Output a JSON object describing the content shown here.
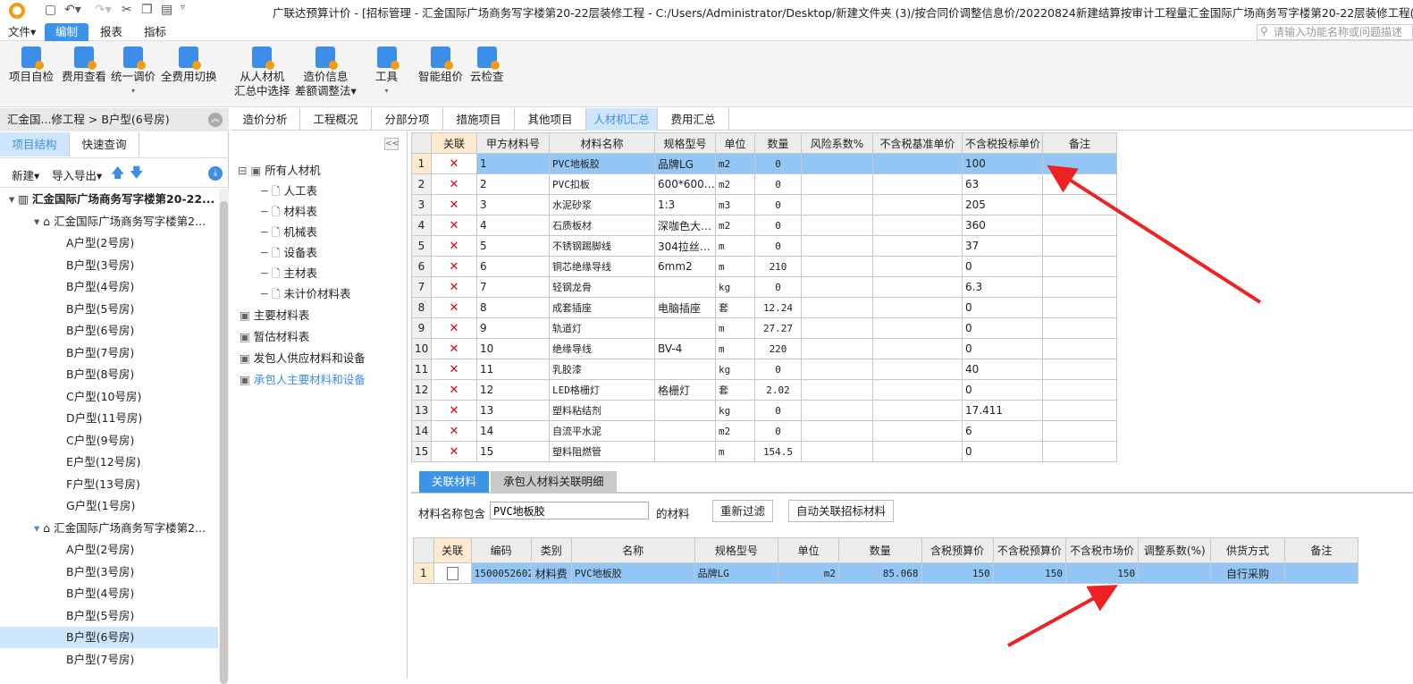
{
  "window": {
    "title": "广联达预算计价 - [招标管理 - 汇金国际广场商务写字楼第20-22层装修工程 - C:/Users/Administrator/Desktop/新建文件夹 (3)/按合同价调整信息价/20220824新建结算按审计工程量汇金国际广场商务写字楼第20-22层装修工程(合同内).G"
  },
  "menu": [
    "文件▾",
    "编制",
    "报表",
    "指标"
  ],
  "search_placeholder": "请输入功能名称或问题描述",
  "ribbon": [
    {
      "l1": "项目自检",
      "l2": ""
    },
    {
      "l1": "费用查看",
      "l2": ""
    },
    {
      "l1": "统一调价",
      "l2": "▾"
    },
    {
      "l1": "全费用切换",
      "l2": ""
    },
    {
      "l1": "从人材机",
      "l2": "汇总中选择"
    },
    {
      "l1": "造价信息",
      "l2": "差额调整法▾"
    },
    {
      "l1": "工具",
      "l2": "▾"
    },
    {
      "l1": "智能组价",
      "l2": ""
    },
    {
      "l1": "云检查",
      "l2": ""
    }
  ],
  "left": {
    "breadcrumb": "汇金国...修工程 > B户型(6号房)",
    "tabs": [
      "项目结构",
      "快速查询"
    ],
    "tools": {
      "new": "新建▾",
      "import": "导入导出▾"
    },
    "tree": [
      "汇金国际广场商务写字楼第20-22...",
      "汇金国际广场商务写字楼第2...",
      "A户型(2号房)",
      "B户型(3号房)",
      "B户型(4号房)",
      "B户型(5号房)",
      "B户型(6号房)",
      "B户型(7号房)",
      "B户型(8号房)",
      "C户型(10号房)",
      "D户型(11号房)",
      "C户型(9号房)",
      "E户型(12号房)",
      "F户型(13号房)",
      "G户型(1号房)",
      "汇金国际广场商务写字楼第2...",
      "A户型(2号房)",
      "B户型(3号房)",
      "B户型(4号房)",
      "B户型(5号房)",
      "B户型(6号房)",
      "B户型(7号房)"
    ]
  },
  "tabs": [
    "造价分析",
    "工程概况",
    "分部分项",
    "措施项目",
    "其他项目",
    "人材机汇总",
    "费用汇总"
  ],
  "mid_tree": [
    "所有人材机",
    "人工表",
    "材料表",
    "机械表",
    "设备表",
    "主材表",
    "未计价材料表",
    "主要材料表",
    "暂估材料表",
    "发包人供应材料和设备",
    "承包人主要材料和设备"
  ],
  "grid": {
    "headers": [
      "关联",
      "甲方材料号",
      "材料名称",
      "规格型号",
      "单位",
      "数量",
      "风险系数%",
      "不含税基准单价",
      "不含税投标单价",
      "备注"
    ],
    "rows": [
      [
        "1",
        "1",
        "PVC地板胶",
        "品牌LG",
        "m2",
        "0",
        "",
        "",
        "100",
        ""
      ],
      [
        "2",
        "2",
        "PVC扣板",
        "600*600…",
        "m2",
        "0",
        "",
        "",
        "63",
        ""
      ],
      [
        "3",
        "3",
        "水泥砂浆",
        "1:3",
        "m3",
        "0",
        "",
        "",
        "205",
        ""
      ],
      [
        "4",
        "4",
        "石质板材",
        "深咖色大…",
        "m2",
        "0",
        "",
        "",
        "360",
        ""
      ],
      [
        "5",
        "5",
        "不锈钢踢脚线",
        "304拉丝…",
        "m",
        "0",
        "",
        "",
        "37",
        ""
      ],
      [
        "6",
        "6",
        "铜芯绝缘导线",
        "6mm2",
        "m",
        "210",
        "",
        "",
        "0",
        ""
      ],
      [
        "7",
        "7",
        "轻钢龙骨",
        "",
        "kg",
        "0",
        "",
        "",
        "6.3",
        ""
      ],
      [
        "8",
        "8",
        "成套插座",
        "电脑插座",
        "套",
        "12.24",
        "",
        "",
        "0",
        ""
      ],
      [
        "9",
        "9",
        "轨道灯",
        "",
        "m",
        "27.27",
        "",
        "",
        "0",
        ""
      ],
      [
        "10",
        "10",
        "绝缘导线",
        "BV-4",
        "m",
        "220",
        "",
        "",
        "0",
        ""
      ],
      [
        "11",
        "11",
        "乳胶漆",
        "",
        "kg",
        "0",
        "",
        "",
        "40",
        ""
      ],
      [
        "12",
        "12",
        "LED格栅灯",
        "格栅灯",
        "套",
        "2.02",
        "",
        "",
        "0",
        ""
      ],
      [
        "13",
        "13",
        "塑料粘结剂",
        "",
        "kg",
        "0",
        "",
        "",
        "17.411",
        ""
      ],
      [
        "14",
        "14",
        "自流平水泥",
        "",
        "m2",
        "0",
        "",
        "",
        "6",
        ""
      ],
      [
        "15",
        "15",
        "塑料阻燃管",
        "",
        "m",
        "154.5",
        "",
        "",
        "0",
        ""
      ]
    ]
  },
  "bottom": {
    "tabs": [
      "关联材料",
      "承包人材料关联明细"
    ],
    "filter_label": "材料名称包含",
    "filter_value": "PVC地板胶",
    "filter_suffix": "的材料",
    "refilter": "重新过滤",
    "auto": "自动关联招标材料",
    "headers": [
      "关联",
      "编码",
      "类别",
      "名称",
      "规格型号",
      "单位",
      "数量",
      "含税预算价",
      "不含税预算价",
      "不含税市场价",
      "调整系数(%)",
      "供货方式",
      "备注"
    ],
    "rows": [
      [
        "1",
        "",
        "1500052602",
        "材料费",
        "PVC地板胶",
        "品牌LG",
        "m2",
        "85.068",
        "150",
        "150",
        "150",
        "",
        "自行采购",
        ""
      ]
    ]
  },
  "colors": {
    "accent": "#3c94e8",
    "selected_row": "#93c6f5",
    "annotation_arrow": "#ee2222"
  }
}
